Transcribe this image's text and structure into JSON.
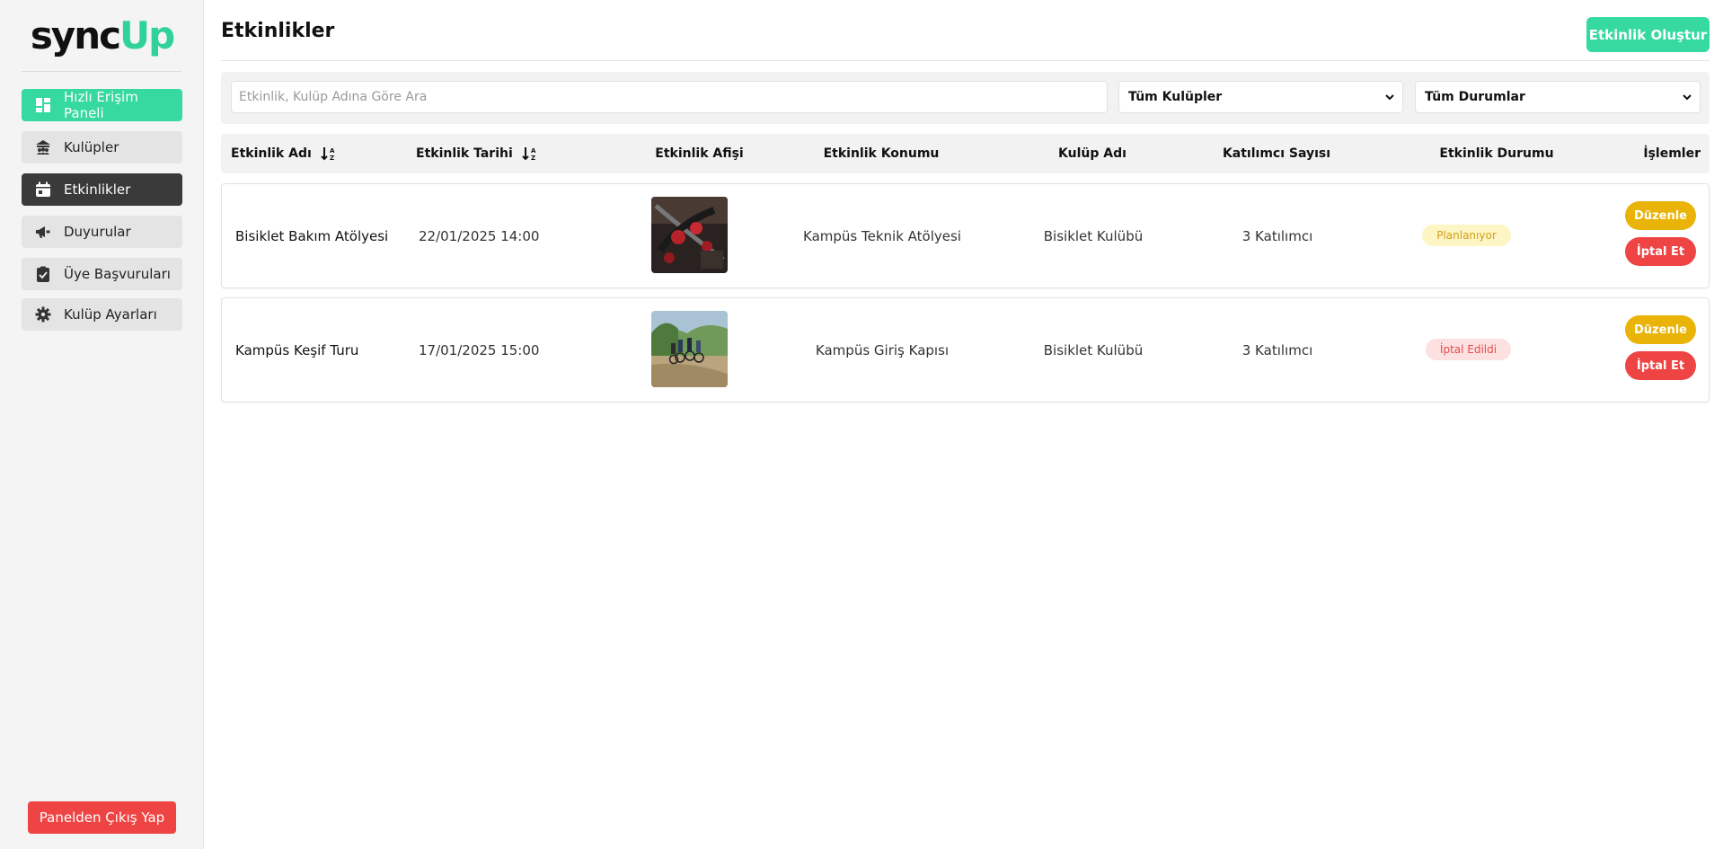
{
  "app": {
    "logo_part1": "sync",
    "logo_part2": "Up"
  },
  "sidebar": {
    "items": [
      {
        "label": "Hızlı Erişim Paneli",
        "icon": "dashboard-icon"
      },
      {
        "label": "Kulüpler",
        "icon": "club-icon"
      },
      {
        "label": "Etkinlikler",
        "icon": "calendar-icon"
      },
      {
        "label": "Duyurular",
        "icon": "megaphone-icon"
      },
      {
        "label": "Üye Başvuruları",
        "icon": "clipboard-check-icon"
      },
      {
        "label": "Kulüp Ayarları",
        "icon": "gear-icon"
      }
    ],
    "logout_label": "Panelden Çıkış Yap"
  },
  "header": {
    "title": "Etkinlikler",
    "create_label": "Etkinlik Oluştur"
  },
  "filters": {
    "search_placeholder": "Etkinlik, Kulüp Adına Göre Ara",
    "club_select": "Tüm Kulüpler",
    "status_select": "Tüm Durumlar"
  },
  "table": {
    "columns": [
      "Etkinlik Adı",
      "Etkinlik Tarihi",
      "Etkinlik Afişi",
      "Etkinlik Konumu",
      "Kulüp Adı",
      "Katılımcı Sayısı",
      "Etkinlik Durumu",
      "İşlemler"
    ],
    "rows": [
      {
        "name": "Bisiklet Bakım Atölyesi",
        "date": "22/01/2025 14:00",
        "location": "Kampüs Teknik Atölyesi",
        "club": "Bisiklet Kulübü",
        "participants": "3 Katılımcı",
        "status": "Planlanıyor",
        "edit_label": "Düzenle",
        "cancel_label": "İptal Et"
      },
      {
        "name": "Kampüs Keşif Turu",
        "date": "17/01/2025 15:00",
        "location": "Kampüs Giriş Kapısı",
        "club": "Bisiklet Kulübü",
        "participants": "3 Katılımcı",
        "status": "İptal Edildi",
        "edit_label": "Düzenle",
        "cancel_label": "İptal Et"
      }
    ]
  },
  "colors": {
    "brand_green": "#36d99f",
    "danger_red": "#ef4444",
    "edit_yellow": "#eab308",
    "sidebar_active": "#3a3a3a"
  }
}
